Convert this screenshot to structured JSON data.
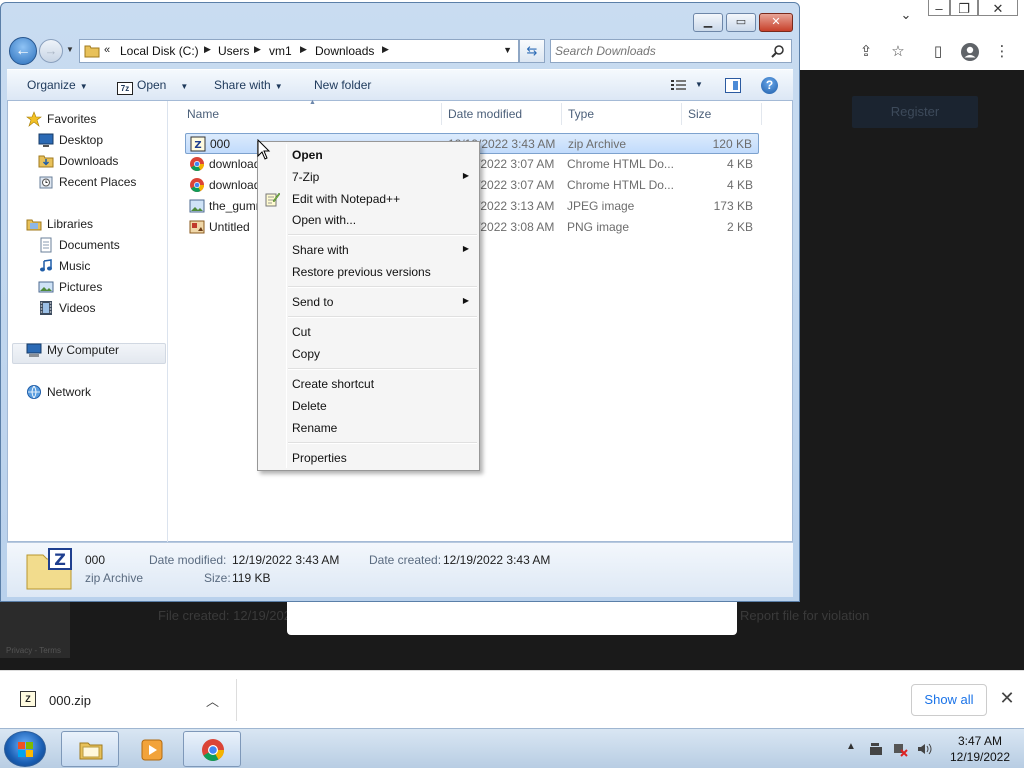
{
  "chrome": {
    "register_label": "Register",
    "file_created_text": "File created: 12/19/2022",
    "report_text": "Report file for violation",
    "recaptcha_text": "Privacy - Terms"
  },
  "explorer": {
    "breadcrumbs": [
      "Local Disk (C:)",
      "Users",
      "vm1",
      "Downloads"
    ],
    "search_placeholder": "Search Downloads",
    "toolbar": {
      "organize": "Organize",
      "open": "Open",
      "share_with": "Share with",
      "new_folder": "New folder"
    },
    "nav": {
      "favorites": "Favorites",
      "desktop": "Desktop",
      "downloads": "Downloads",
      "recent_places": "Recent Places",
      "libraries": "Libraries",
      "documents": "Documents",
      "music": "Music",
      "pictures": "Pictures",
      "videos": "Videos",
      "my_computer": "My Computer",
      "network": "Network"
    },
    "columns": {
      "name": "Name",
      "date_modified": "Date modified",
      "type": "Type",
      "size": "Size"
    },
    "files": [
      {
        "name": "000",
        "date": "12/19/2022 3:43 AM",
        "type": "zip Archive",
        "size": "120 KB",
        "icon": "zip-icon"
      },
      {
        "name": "download",
        "date": "12/19/2022 3:07 AM",
        "type": "Chrome HTML Do...",
        "size": "4 KB",
        "icon": "chrome-html-icon"
      },
      {
        "name": "download",
        "date": "12/19/2022 3:07 AM",
        "type": "Chrome HTML Do...",
        "size": "4 KB",
        "icon": "chrome-html-icon"
      },
      {
        "name": "the_gummy",
        "date": "12/19/2022 3:13 AM",
        "type": "JPEG image",
        "size": "173 KB",
        "icon": "jpeg-icon"
      },
      {
        "name": "Untitled",
        "date": "12/19/2022 3:08 AM",
        "type": "PNG image",
        "size": "2 KB",
        "icon": "png-icon"
      }
    ],
    "details": {
      "name": "000",
      "type": "zip Archive",
      "date_modified_label": "Date modified:",
      "date_modified": "12/19/2022 3:43 AM",
      "date_created_label": "Date created:",
      "date_created": "12/19/2022 3:43 AM",
      "size_label": "Size:",
      "size": "119 KB"
    }
  },
  "context_menu": {
    "open": "Open",
    "seven_zip": "7-Zip",
    "edit_notepad": "Edit with Notepad++",
    "open_with": "Open with...",
    "share_with": "Share with",
    "restore": "Restore previous versions",
    "send_to": "Send to",
    "cut": "Cut",
    "copy": "Copy",
    "create_shortcut": "Create shortcut",
    "delete": "Delete",
    "rename": "Rename",
    "properties": "Properties"
  },
  "downloads_bar": {
    "file": "000.zip",
    "show_all": "Show all"
  },
  "taskbar": {
    "time": "3:47 AM",
    "date": "12/19/2022"
  }
}
